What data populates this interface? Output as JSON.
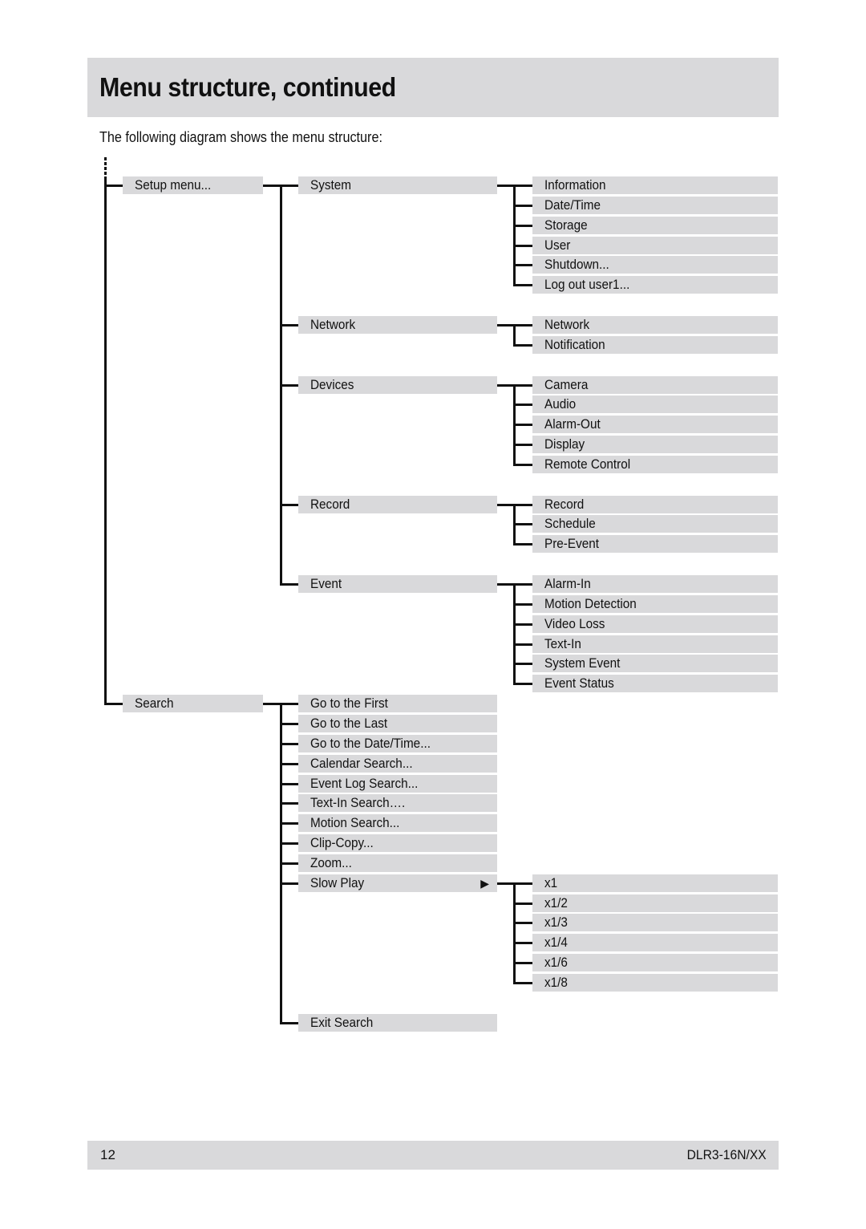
{
  "header": {
    "title": "Menu structure, continued"
  },
  "intro": "The following diagram shows the menu structure:",
  "menu": {
    "level1": [
      {
        "label": "Setup menu...",
        "row": 0
      },
      {
        "label": "Search",
        "row": 26
      }
    ],
    "setup_children": [
      {
        "label": "System",
        "row": 0,
        "children": [
          "Information",
          "Date/Time",
          "Storage",
          "User",
          "Shutdown...",
          "Log out user1..."
        ]
      },
      {
        "label": "Network",
        "row": 7,
        "children": [
          "Network",
          "Notification"
        ]
      },
      {
        "label": "Devices",
        "row": 10,
        "children": [
          "Camera",
          "Audio",
          "Alarm-Out",
          "Display",
          "Remote Control"
        ]
      },
      {
        "label": "Record",
        "row": 16,
        "children": [
          "Record",
          "Schedule",
          "Pre-Event"
        ]
      },
      {
        "label": "Event",
        "row": 20,
        "children": [
          "Alarm-In",
          "Motion Detection",
          "Video Loss",
          "Text-In",
          "System Event",
          "Event Status"
        ]
      }
    ],
    "search_children": [
      {
        "label": "Go to the First",
        "row": 26
      },
      {
        "label": "Go to the Last",
        "row": 27
      },
      {
        "label": "Go to the Date/Time...",
        "row": 28
      },
      {
        "label": "Calendar Search...",
        "row": 29
      },
      {
        "label": "Event Log Search...",
        "row": 30
      },
      {
        "label": "Text-In Search….",
        "row": 31
      },
      {
        "label": "Motion Search...",
        "row": 32
      },
      {
        "label": "Clip-Copy...",
        "row": 33
      },
      {
        "label": "Zoom...",
        "row": 34
      },
      {
        "label": "Slow Play",
        "row": 35,
        "submenu_icon": "right-triangle-arrow",
        "children": [
          "x1",
          "x1/2",
          "x1/3",
          "x1/4",
          "x1/6",
          "x1/8"
        ]
      },
      {
        "label": "Exit Search",
        "row": 42
      }
    ]
  },
  "footer": {
    "page_number": "12",
    "model": "DLR3-16N/XX"
  }
}
